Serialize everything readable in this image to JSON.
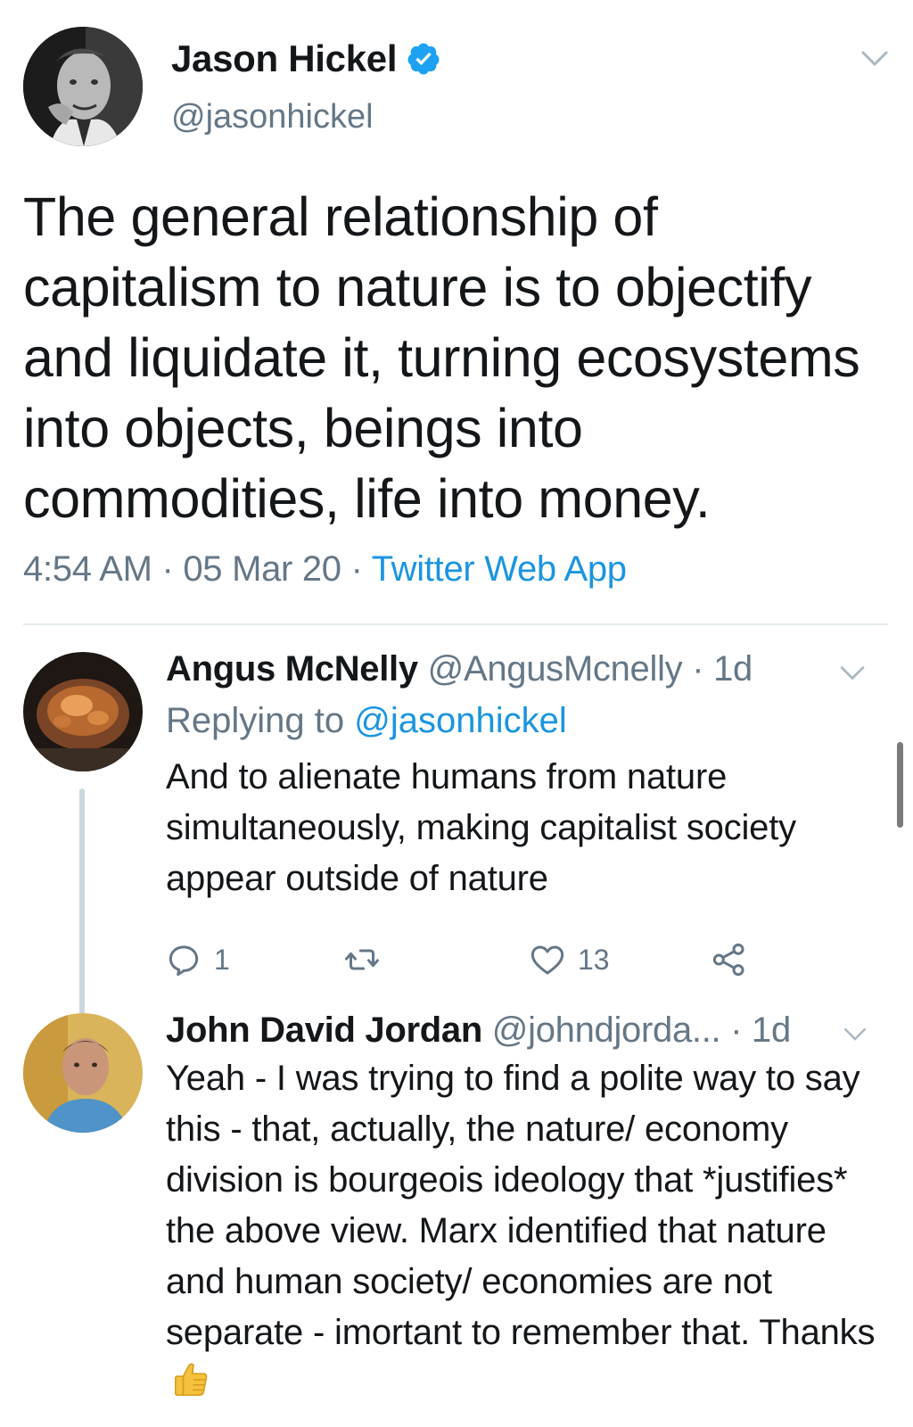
{
  "main_tweet": {
    "name": "Jason Hickel",
    "handle": "@jasonhickel",
    "text": "The general relationship of capitalism to nature is to objectify and liquidate it, turning ecosystems into objects, beings into commodities, life into money.",
    "time": "4:54 AM",
    "date": "05 Mar 20",
    "source": "Twitter Web App",
    "separator": "·"
  },
  "replies": [
    {
      "name": "Angus McNelly",
      "handle": "@AngusMcnelly",
      "age": "1d",
      "replying_prefix": "Replying to",
      "replying_to": "@jasonhickel",
      "text": "And to alienate humans from nature simultaneously, making capitalist society appear outside of nature",
      "reply_count": "1",
      "like_count": "13"
    },
    {
      "name": "John David Jordan",
      "handle": "@johndjorda...",
      "age": "1d",
      "text": "Yeah - I was trying to find a polite way to say this - that, actually, the nature/ economy division is bourgeois ideology that *justifies* the above view. Marx identified that nature and human society/ economies are not separate - imortant to remember that. Thanks"
    }
  ],
  "icons": {
    "verified": "verified-badge-icon",
    "caret": "chevron-down-icon",
    "reply": "reply-icon",
    "retweet": "retweet-icon",
    "like": "heart-icon",
    "share": "share-icon",
    "emoji": "thumbs-up-emoji"
  },
  "colors": {
    "link": "#1b95e0",
    "secondary": "#657786",
    "text": "#14171a",
    "verified": "#1da1f2"
  }
}
